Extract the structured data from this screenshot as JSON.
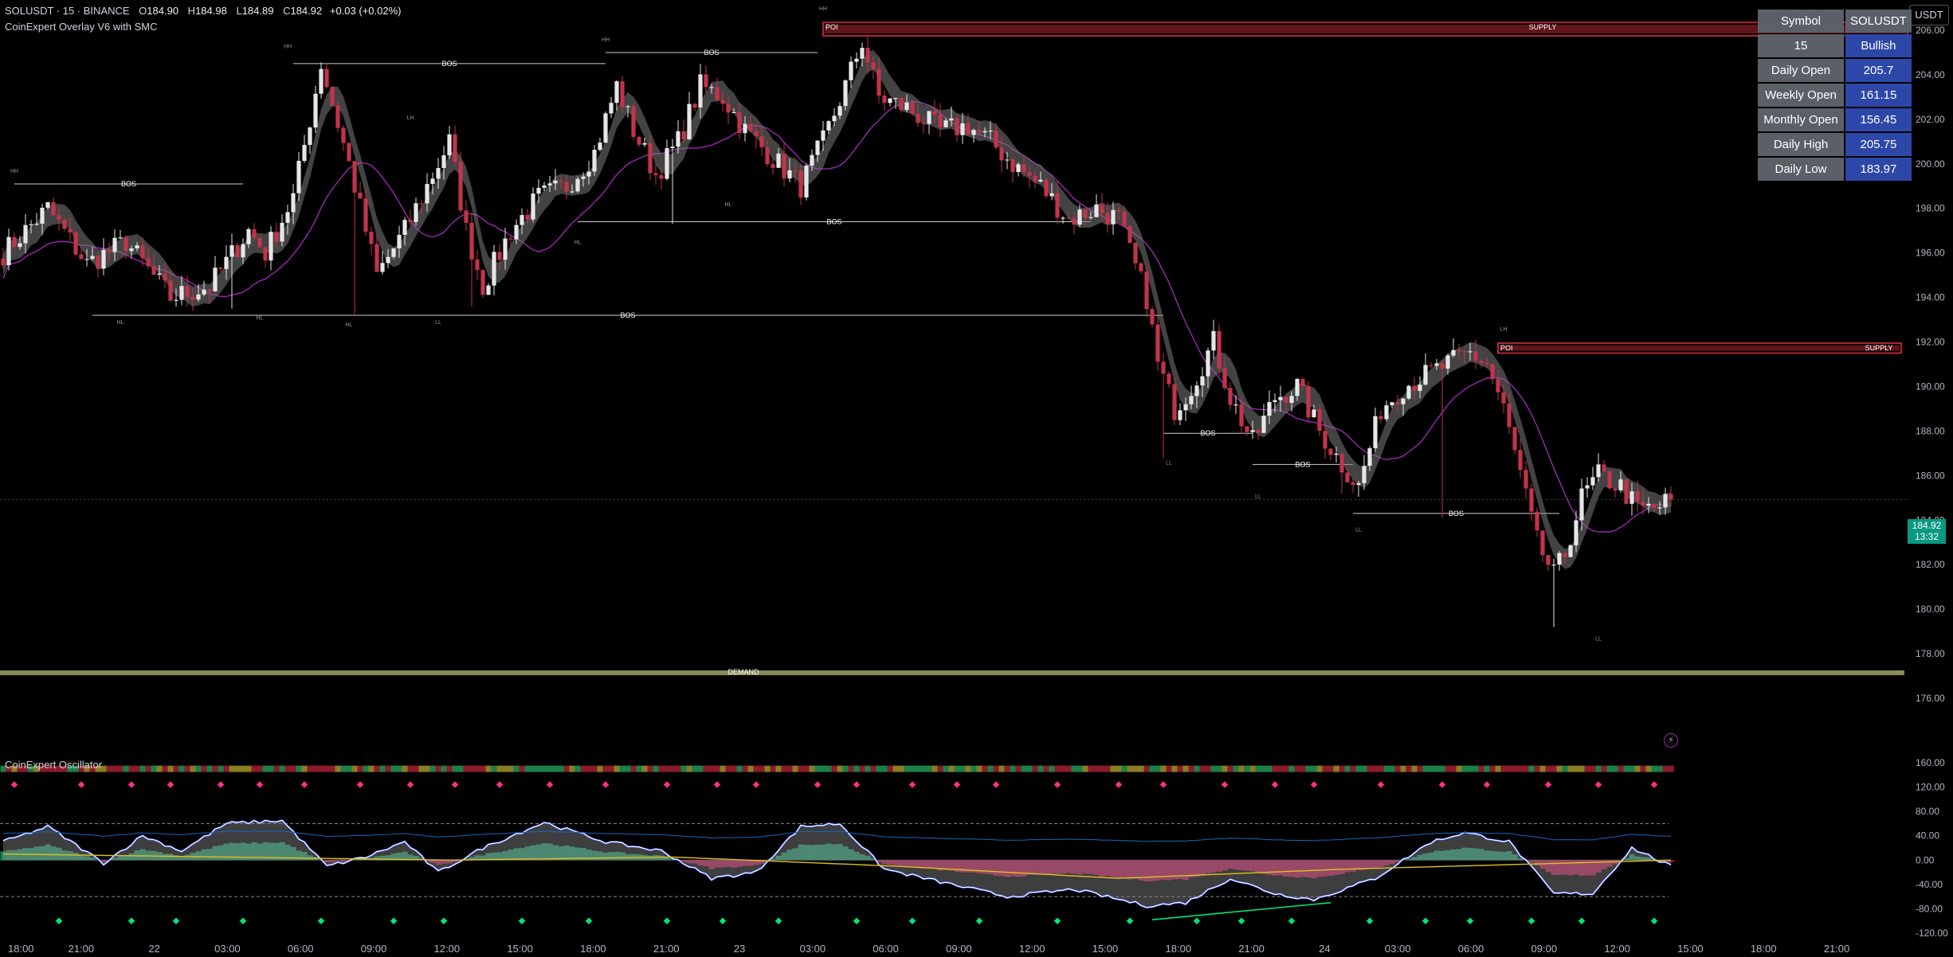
{
  "header": {
    "symbol_line": "SOLUSDT · 15 · BINANCE",
    "open_label": "O",
    "open": "184.90",
    "high_label": "H",
    "high": "184.98",
    "low_label": "L",
    "low": "184.89",
    "close_label": "C",
    "close": "184.92",
    "change": "+0.03 (+0.02%)",
    "indicator": "CoinExpert Overlay V6 with SMC",
    "currency": "USDT"
  },
  "oscillator_title": "CoinExpert Oscillator",
  "price_tag": {
    "price": "184.92",
    "countdown": "13:32"
  },
  "bolt_icon": "lightning-icon",
  "info_table": {
    "header": [
      "Symbol",
      "SOLUSDT"
    ],
    "rows": [
      {
        "k": "15",
        "v": "Bullish"
      },
      {
        "k": "Daily Open",
        "v": "205.7"
      },
      {
        "k": "Weekly Open",
        "v": "161.15"
      },
      {
        "k": "Monthly Open",
        "v": "156.45"
      },
      {
        "k": "Daily High",
        "v": "205.75"
      },
      {
        "k": "Daily Low",
        "v": "183.97"
      }
    ]
  },
  "colors": {
    "up": "#e6e6e6",
    "down": "#c2344a",
    "supply": "#b22833",
    "demand": "#8b8b5a",
    "trail": "#9c27b0",
    "grid_text": "#b2b5be",
    "osc_green": "#1e9c6e",
    "osc_pink": "#c2185b"
  },
  "chart_data": [
    {
      "type": "candlestick",
      "title": "SOLUSDT · 15 · BINANCE",
      "ylim": [
        175,
        207
      ],
      "y_ticks": [
        "206.00",
        "204.00",
        "202.00",
        "200.00",
        "198.00",
        "196.00",
        "194.00",
        "192.00",
        "190.00",
        "188.00",
        "186.00",
        "184.00",
        "182.00",
        "180.00",
        "178.00",
        "176.00"
      ],
      "x_ticks": [
        "18:00",
        "21:00",
        "22",
        "03:00",
        "06:00",
        "09:00",
        "12:00",
        "15:00",
        "18:00",
        "21:00",
        "23",
        "03:00",
        "06:00",
        "09:00",
        "12:00",
        "15:00",
        "18:00",
        "21:00",
        "24",
        "03:00",
        "06:00",
        "09:00",
        "12:00",
        "15:00",
        "18:00",
        "21:00"
      ],
      "anchors": [
        [
          0,
          196
        ],
        [
          8,
          198
        ],
        [
          15,
          195.5
        ],
        [
          22,
          196.5
        ],
        [
          30,
          194
        ],
        [
          37,
          194.5
        ],
        [
          44,
          197
        ],
        [
          47,
          196
        ],
        [
          52,
          198.5
        ],
        [
          55,
          202
        ],
        [
          57,
          204.5
        ],
        [
          62,
          200
        ],
        [
          67,
          195
        ],
        [
          72,
          197
        ],
        [
          76,
          199
        ],
        [
          80,
          201
        ],
        [
          83,
          197
        ],
        [
          86,
          194.5
        ],
        [
          91,
          197
        ],
        [
          96,
          198.5
        ],
        [
          101,
          199
        ],
        [
          106,
          200.5
        ],
        [
          110,
          203.5
        ],
        [
          113,
          201.5
        ],
        [
          117,
          199.5
        ],
        [
          121,
          201
        ],
        [
          125,
          203.5
        ],
        [
          129,
          203
        ],
        [
          133,
          201.5
        ],
        [
          139,
          200
        ],
        [
          143,
          199
        ],
        [
          147,
          201
        ],
        [
          151,
          203.5
        ],
        [
          154,
          205.5
        ],
        [
          157,
          203
        ],
        [
          162,
          202.5
        ],
        [
          168,
          201.5
        ],
        [
          173,
          201.7
        ],
        [
          177,
          201
        ],
        [
          181,
          200
        ],
        [
          186,
          199
        ],
        [
          191,
          197.5
        ],
        [
          196,
          198
        ],
        [
          200,
          197.5
        ],
        [
          202,
          196
        ],
        [
          205,
          194
        ],
        [
          207,
          191
        ],
        [
          210,
          189
        ],
        [
          213,
          190
        ],
        [
          217,
          192
        ],
        [
          220,
          189.5
        ],
        [
          224,
          187.5
        ],
        [
          228,
          189.5
        ],
        [
          232,
          190
        ],
        [
          236,
          188
        ],
        [
          240,
          186.5
        ],
        [
          243,
          185.5
        ],
        [
          247,
          189
        ],
        [
          251,
          190
        ],
        [
          255,
          190.5
        ],
        [
          259,
          191
        ],
        [
          263,
          191.5
        ],
        [
          266,
          191
        ],
        [
          269,
          189
        ],
        [
          272,
          186
        ],
        [
          275,
          183
        ],
        [
          278,
          181.5
        ],
        [
          280,
          182.5
        ],
        [
          283,
          185
        ],
        [
          286,
          186
        ],
        [
          290,
          185.5
        ],
        [
          293,
          184.5
        ],
        [
          296,
          184.5
        ],
        [
          299,
          184.9
        ]
      ],
      "lows": {
        "41": 193.5,
        "63": 193.2,
        "84": 193.6,
        "120": 197.3,
        "168": 201.2,
        "208": 186.8,
        "240": 185.2,
        "258": 184.1,
        "278": 179.2
      },
      "supply_zones": [
        {
          "label": "SUPPLY",
          "top": 206.35,
          "bottom": 205.75,
          "from_bar": 147
        },
        {
          "label": "SUPPLY",
          "top": 191.95,
          "bottom": 191.5,
          "from_bar": 268
        }
      ],
      "demand_zones": [
        {
          "label": "DEMAND",
          "top": 177.25,
          "bottom": 176.95,
          "from_bar": 0
        }
      ],
      "poi_labels": [
        "POI",
        "POI"
      ],
      "bos_lines": [
        {
          "label": "BOS",
          "price": 199.1,
          "from_bar": 2,
          "to_bar": 43
        },
        {
          "label": "BOS",
          "price": 193.2,
          "from_bar": 16,
          "to_bar": 208
        },
        {
          "label": "BOS",
          "price": 204.5,
          "from_bar": 52,
          "to_bar": 108
        },
        {
          "label": "BOS",
          "price": 205.0,
          "from_bar": 108,
          "to_bar": 146
        },
        {
          "label": "BOS",
          "price": 197.4,
          "from_bar": 103,
          "to_bar": 195
        },
        {
          "label": "BOS",
          "price": 187.9,
          "from_bar": 208,
          "to_bar": 224
        },
        {
          "label": "BOS",
          "price": 186.5,
          "from_bar": 224,
          "to_bar": 242
        },
        {
          "label": "BOS",
          "price": 184.3,
          "from_bar": 242,
          "to_bar": 279
        }
      ],
      "swing_labels": [
        {
          "label": "HH",
          "bar": 2,
          "price": 199.6
        },
        {
          "label": "HL",
          "bar": 21,
          "price": 192.8
        },
        {
          "label": "HH",
          "bar": 51,
          "price": 205.2
        },
        {
          "label": "HL",
          "bar": 46,
          "price": 193.0
        },
        {
          "label": "HL",
          "bar": 62,
          "price": 192.7
        },
        {
          "label": "LH",
          "bar": 73,
          "price": 202.0
        },
        {
          "label": "LL",
          "bar": 78,
          "price": 192.8
        },
        {
          "label": "HH",
          "bar": 108,
          "price": 205.5
        },
        {
          "label": "HL",
          "bar": 103,
          "price": 196.4
        },
        {
          "label": "HL",
          "bar": 130,
          "price": 198.1
        },
        {
          "label": "HH",
          "bar": 147,
          "price": 206.9
        },
        {
          "label": "LL",
          "bar": 209,
          "price": 186.5
        },
        {
          "label": "LL",
          "bar": 225,
          "price": 185.0
        },
        {
          "label": "LL",
          "bar": 243,
          "price": 183.5
        },
        {
          "label": "LH",
          "bar": 269,
          "price": 192.5
        },
        {
          "label": "LL",
          "bar": 286,
          "price": 178.6
        }
      ]
    },
    {
      "type": "line",
      "title": "CoinExpert Oscillator",
      "ylim": [
        -120,
        160
      ],
      "y_ticks": [
        "160.00",
        "120.00",
        "80.00",
        "40.00",
        "0.00",
        "-40.00",
        "-80.00",
        "-120.00"
      ],
      "levels": [
        60,
        -60
      ],
      "fast_anchors": [
        [
          0,
          30
        ],
        [
          8,
          55
        ],
        [
          18,
          -5
        ],
        [
          25,
          40
        ],
        [
          32,
          15
        ],
        [
          40,
          60
        ],
        [
          50,
          65
        ],
        [
          58,
          -10
        ],
        [
          65,
          5
        ],
        [
          72,
          30
        ],
        [
          78,
          -20
        ],
        [
          86,
          20
        ],
        [
          97,
          62
        ],
        [
          108,
          30
        ],
        [
          118,
          15
        ],
        [
          127,
          -30
        ],
        [
          135,
          -20
        ],
        [
          143,
          55
        ],
        [
          150,
          60
        ],
        [
          158,
          -15
        ],
        [
          170,
          -40
        ],
        [
          180,
          -60
        ],
        [
          192,
          -48
        ],
        [
          205,
          -75
        ],
        [
          212,
          -70
        ],
        [
          220,
          -30
        ],
        [
          228,
          -55
        ],
        [
          235,
          -65
        ],
        [
          246,
          -30
        ],
        [
          256,
          30
        ],
        [
          262,
          45
        ],
        [
          270,
          30
        ],
        [
          278,
          -55
        ],
        [
          285,
          -55
        ],
        [
          292,
          20
        ],
        [
          299,
          -10
        ]
      ],
      "slow_anchors": [
        [
          0,
          10
        ],
        [
          40,
          5
        ],
        [
          80,
          0
        ],
        [
          120,
          5
        ],
        [
          160,
          -10
        ],
        [
          200,
          -30
        ],
        [
          240,
          -15
        ],
        [
          280,
          -5
        ],
        [
          299,
          0
        ]
      ]
    }
  ]
}
